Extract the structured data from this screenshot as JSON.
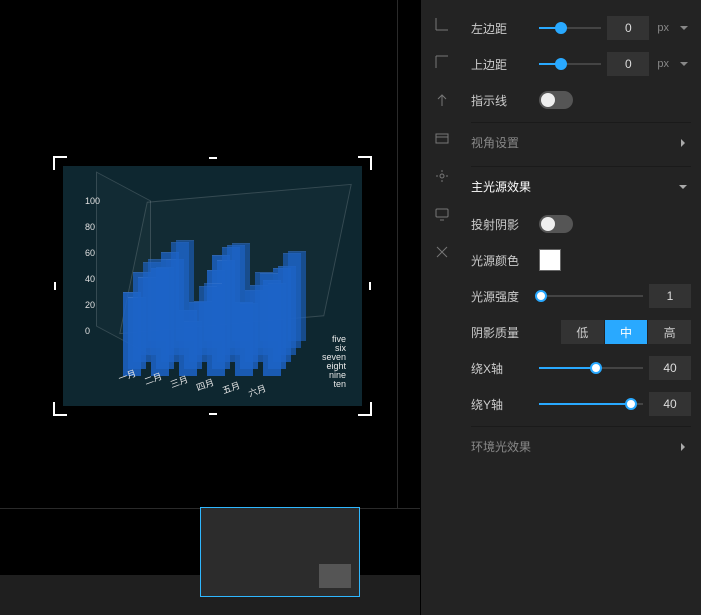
{
  "panel": {
    "left_margin": {
      "label": "左边距",
      "value": 0,
      "unit": "px",
      "pct": 35
    },
    "top_margin": {
      "label": "上边距",
      "value": 0,
      "unit": "px",
      "pct": 35
    },
    "guide_line": {
      "label": "指示线"
    },
    "view_settings": {
      "label": "视角设置"
    },
    "main_light": {
      "label": "主光源效果"
    },
    "cast_shadow": {
      "label": "投射阴影"
    },
    "light_color": {
      "label": "光源颜色",
      "value": "#ffffff"
    },
    "light_intensity": {
      "label": "光源强度",
      "value": 1,
      "pct": 2
    },
    "shadow_quality": {
      "label": "阴影质量",
      "options": [
        "低",
        "中",
        "高"
      ],
      "selected": 1
    },
    "rotate_x": {
      "label": "绕X轴",
      "value": 40,
      "pct": 55
    },
    "rotate_y": {
      "label": "绕Y轴",
      "value": 40,
      "pct": 88
    },
    "ambient_light": {
      "label": "环境光效果"
    }
  },
  "chart_data": {
    "type": "bar",
    "title": "",
    "xlabel": "",
    "ylabel": "",
    "ylim": [
      0,
      100
    ],
    "yticks": [
      0,
      20,
      40,
      60,
      80,
      100
    ],
    "categories": [
      "一月",
      "二月",
      "三月",
      "四月",
      "五月",
      "六月"
    ],
    "series_labels": [
      "five",
      "six",
      "seven",
      "eight",
      "nine",
      "ten"
    ],
    "series": [
      {
        "name": "five",
        "values": [
          70,
          90,
          55,
          88,
          62,
          80
        ]
      },
      {
        "name": "six",
        "values": [
          60,
          85,
          40,
          95,
          55,
          72
        ]
      },
      {
        "name": "seven",
        "values": [
          75,
          92,
          50,
          85,
          60,
          78
        ]
      },
      {
        "name": "eight",
        "values": [
          65,
          80,
          45,
          90,
          58,
          74
        ]
      },
      {
        "name": "nine",
        "values": [
          72,
          88,
          52,
          86,
          63,
          79
        ]
      },
      {
        "name": "ten",
        "values": [
          68,
          84,
          48,
          82,
          57,
          75
        ]
      }
    ]
  }
}
